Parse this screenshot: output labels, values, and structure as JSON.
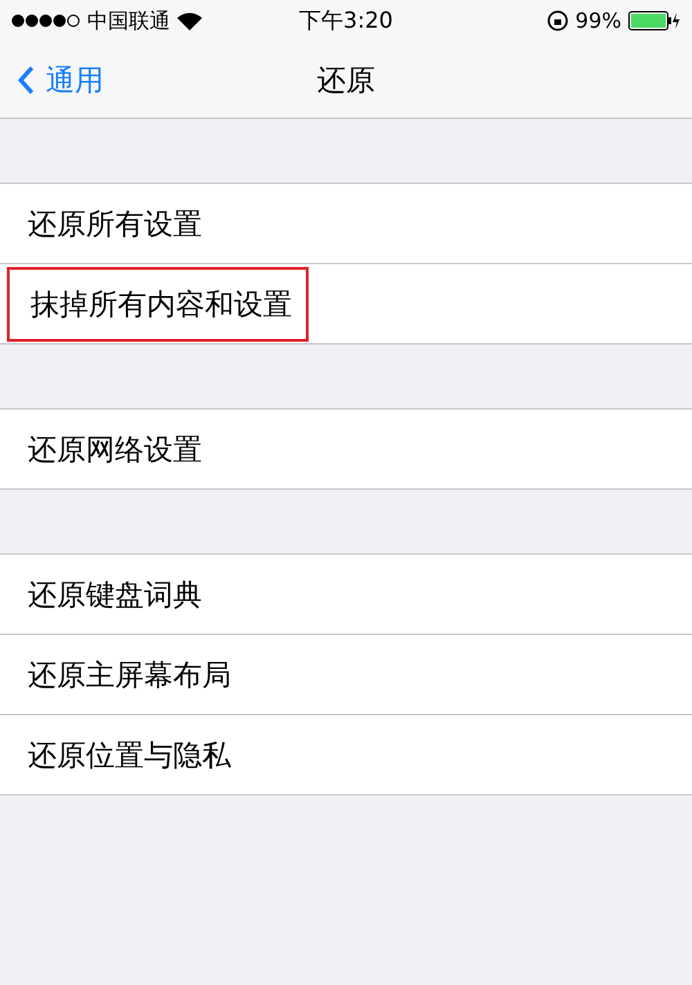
{
  "status_bar": {
    "carrier": "中国联通",
    "time": "下午3:20",
    "battery": "99%"
  },
  "nav": {
    "back": "通用",
    "title": "还原"
  },
  "groups": [
    {
      "items": [
        {
          "label": "还原所有设置",
          "highlighted": false
        },
        {
          "label": "抹掉所有内容和设置",
          "highlighted": true
        }
      ]
    },
    {
      "items": [
        {
          "label": "还原网络设置",
          "highlighted": false
        }
      ]
    },
    {
      "items": [
        {
          "label": "还原键盘词典",
          "highlighted": false
        },
        {
          "label": "还原主屏幕布局",
          "highlighted": false
        },
        {
          "label": "还原位置与隐私",
          "highlighted": false
        }
      ]
    }
  ]
}
